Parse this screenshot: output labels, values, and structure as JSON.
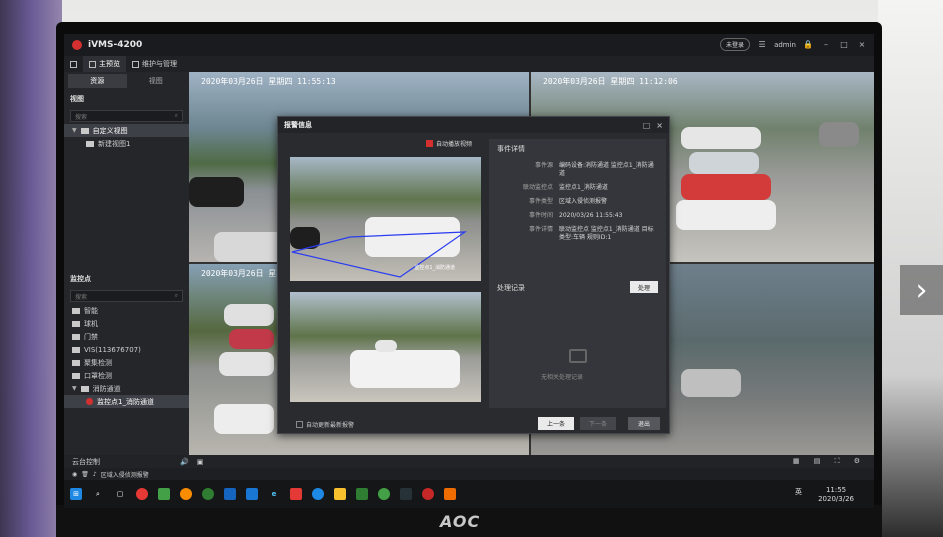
{
  "app": {
    "title": "iVMS-4200",
    "user": "admin",
    "pill": "未登录"
  },
  "menu": {
    "items": [
      {
        "label": "主预览"
      },
      {
        "label": "维护与管理"
      }
    ]
  },
  "left_panel": {
    "tabs": [
      "资源",
      "视图"
    ],
    "view_section": "视图",
    "view_search_placeholder": "搜索",
    "view_tree": [
      {
        "label": "自定义视图"
      },
      {
        "label": "新建视图1"
      }
    ],
    "monitor_section": "监控点",
    "monitor_search_placeholder": "搜索",
    "monitor_tree": [
      {
        "label": "智能"
      },
      {
        "label": "球机"
      },
      {
        "label": "门禁"
      },
      {
        "label": "VIS(113676707)"
      },
      {
        "label": "聚集检测"
      },
      {
        "label": "口罩检测"
      },
      {
        "label": "消防通道"
      },
      {
        "label": "监控点1_消防通道"
      }
    ]
  },
  "video": {
    "tile1_ts": "2020年03月26日 星期四 11:55:13",
    "tile2_ts": "2020年03月26日 星期四 11:12:06",
    "tile3_ts": "2020年03月26日 星期"
  },
  "bottom": {
    "ptz_label": "云台控制",
    "alarm_text": "区域入侵侦测报警"
  },
  "taskbar": {
    "time": "11:55",
    "date": "2020/3/26",
    "ime": "英"
  },
  "dialog": {
    "title": "报警信息",
    "autoplay_label": "自动播放视频",
    "snap_label": "监控点1_消防通道",
    "detail_heading": "事件详情",
    "details": [
      {
        "key": "事件源",
        "value": "编码设备:消防通道 监控点1_消防通道"
      },
      {
        "key": "联动监控点",
        "value": "监控点1_消防通道"
      },
      {
        "key": "事件类型",
        "value": "区域入侵侦测报警"
      },
      {
        "key": "事件时间",
        "value": "2020/03/26 11:55:43"
      },
      {
        "key": "事件详情",
        "value": "联动监控点 监控点1_消防通道 目标类型:车辆 规则ID:1"
      }
    ],
    "process_heading": "处理记录",
    "process_button": "处理",
    "empty_text": "无相关处理记录",
    "auto_refresh_label": "自动更新最新报警",
    "btn_prev": "上一条",
    "btn_next": "下一条",
    "btn_close": "退出"
  },
  "monitor_brand": "AOC"
}
